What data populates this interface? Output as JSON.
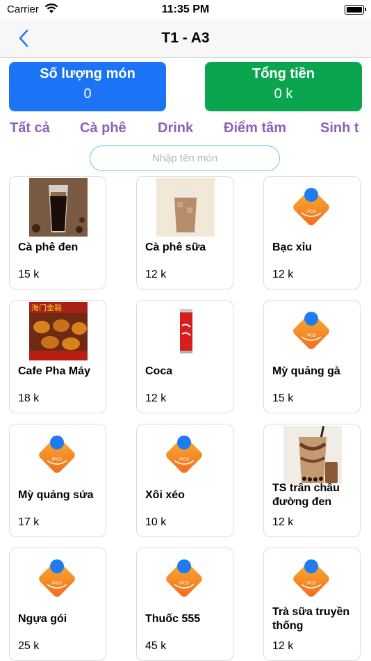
{
  "status_bar": {
    "carrier": "Carrier",
    "time": "11:35 PM"
  },
  "nav": {
    "title": "T1 - A3"
  },
  "summary": {
    "quantity_label": "Số lượng món",
    "quantity_value": "0",
    "total_label": "Tổng tiền",
    "total_value": "0 k"
  },
  "tabs": [
    "Tất cả",
    "Cà phê",
    "Drink",
    "Điểm tâm",
    "Sinh t"
  ],
  "search": {
    "placeholder": "Nhập tên món",
    "value": ""
  },
  "products": [
    {
      "name": "Cà phê đen",
      "price": "15 k",
      "image": "black-coffee-photo"
    },
    {
      "name": "Cà phê sữa",
      "price": "12 k",
      "image": "milk-coffee-photo"
    },
    {
      "name": "Bạc xỉu",
      "price": "12 k",
      "image": "ipos-logo"
    },
    {
      "name": "Cafe Pha Máy",
      "price": "18 k",
      "image": "roast-duck-photo"
    },
    {
      "name": "Coca",
      "price": "12 k",
      "image": "coca-cola-can-photo"
    },
    {
      "name": "Mỳ quảng gà",
      "price": "15 k",
      "image": "ipos-logo"
    },
    {
      "name": "Mỳ quảng sứa",
      "price": "17 k",
      "image": "ipos-logo"
    },
    {
      "name": "Xôi xéo",
      "price": "10 k",
      "image": "ipos-logo"
    },
    {
      "name": "TS trân châu đường đen",
      "price": "12 k",
      "image": "bubble-tea-photo"
    },
    {
      "name": "Ngựa gói",
      "price": "25 k",
      "image": "ipos-logo"
    },
    {
      "name": "Thuốc 555",
      "price": "45 k",
      "image": "ipos-logo"
    },
    {
      "name": "Trà sữa truyền thống",
      "price": "12 k",
      "image": "ipos-logo"
    }
  ],
  "logo_text": "IPOS",
  "duck_sign_text": "海门金鞋",
  "colors": {
    "quantity_card": "#1b74f5",
    "total_card": "#0aa64f",
    "tab_text": "#8a62b8",
    "back_chevron": "#1a7cf5",
    "search_border": "#72c7e3",
    "logo_orange": "#f7931e",
    "logo_blue": "#1e7cf0"
  }
}
